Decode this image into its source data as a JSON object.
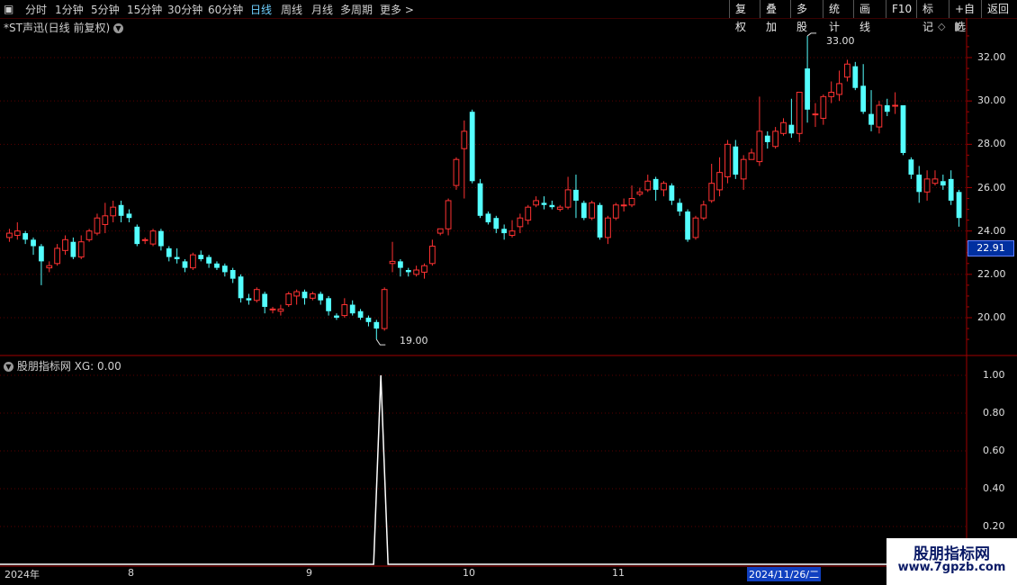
{
  "toolbar": {
    "left_items": [
      "分时",
      "1分钟",
      "5分钟",
      "15分钟",
      "30分钟",
      "60分钟",
      "日线",
      "周线",
      "月线",
      "多周期",
      "更多 >"
    ],
    "active_index": 6,
    "right_items": [
      "复权",
      "叠加",
      "多股",
      "统计",
      "画线",
      "F10",
      "标记",
      "+自选",
      "返回"
    ]
  },
  "chart_title": "*ST声迅(日线 前复权)",
  "indicator_title": "股朋指标网 XG: 0.00",
  "current_price": "22.91",
  "high_marker": "33.00",
  "low_marker": "19.00",
  "x_labels": [
    "2024年",
    "8",
    "9",
    "10",
    "11"
  ],
  "date_highlight": "2024/11/26/二",
  "logo": {
    "cn": "股朋指标网",
    "url": "www.7gpzb.com"
  },
  "colors": {
    "up": "#ff3232",
    "down": "#54ffff",
    "grid": "#5a0000",
    "axis": "#a00000",
    "signal": "#ffffff"
  },
  "chart_data": [
    {
      "type": "candlestick",
      "y_axis_labels": [
        "32.00",
        "30.00",
        "28.00",
        "26.00",
        "24.00",
        "22.00",
        "20.00"
      ],
      "ylim": [
        18.2,
        33.8
      ],
      "candles": [
        [
          23.7,
          23.9,
          23.5,
          24.1
        ],
        [
          23.8,
          24.0,
          23.6,
          24.4
        ],
        [
          23.9,
          23.6,
          23.4,
          24.0
        ],
        [
          23.6,
          23.3,
          22.9,
          23.7
        ],
        [
          23.3,
          22.6,
          21.5,
          23.4
        ],
        [
          22.3,
          22.4,
          22.1,
          22.6
        ],
        [
          22.5,
          23.2,
          22.4,
          23.4
        ],
        [
          23.1,
          23.6,
          22.9,
          23.8
        ],
        [
          23.5,
          22.8,
          22.7,
          23.7
        ],
        [
          22.8,
          23.5,
          22.7,
          23.8
        ],
        [
          23.6,
          24.0,
          23.5,
          24.1
        ],
        [
          23.9,
          24.6,
          23.8,
          24.8
        ],
        [
          24.3,
          24.7,
          23.9,
          25.3
        ],
        [
          24.7,
          25.1,
          24.4,
          25.4
        ],
        [
          25.2,
          24.7,
          24.4,
          25.4
        ],
        [
          24.8,
          24.6,
          24.4,
          25.0
        ],
        [
          24.2,
          23.4,
          23.3,
          24.3
        ],
        [
          23.6,
          23.6,
          23.4,
          23.7
        ],
        [
          23.4,
          24.0,
          23.3,
          24.1
        ],
        [
          24.0,
          23.3,
          23.1,
          24.1
        ],
        [
          23.2,
          22.8,
          22.6,
          23.3
        ],
        [
          22.8,
          22.7,
          22.5,
          23.2
        ],
        [
          22.6,
          22.3,
          22.1,
          22.7
        ],
        [
          22.3,
          22.9,
          22.2,
          23.0
        ],
        [
          22.9,
          22.7,
          22.6,
          23.1
        ],
        [
          22.8,
          22.5,
          22.3,
          22.9
        ],
        [
          22.5,
          22.3,
          22.2,
          22.6
        ],
        [
          22.4,
          22.1,
          21.9,
          22.5
        ],
        [
          22.2,
          21.8,
          21.6,
          22.3
        ],
        [
          21.9,
          20.9,
          20.7,
          22.0
        ],
        [
          20.9,
          20.8,
          20.6,
          21.1
        ],
        [
          20.8,
          21.3,
          20.7,
          21.4
        ],
        [
          21.1,
          20.5,
          20.2,
          21.2
        ],
        [
          20.4,
          20.4,
          20.2,
          20.5
        ],
        [
          20.3,
          20.4,
          20.1,
          20.6
        ],
        [
          20.6,
          21.1,
          20.5,
          21.2
        ],
        [
          21.0,
          21.2,
          20.6,
          21.3
        ],
        [
          21.2,
          20.9,
          20.6,
          21.3
        ],
        [
          20.9,
          21.1,
          20.8,
          21.2
        ],
        [
          21.1,
          20.8,
          20.6,
          21.2
        ],
        [
          20.9,
          20.3,
          20.1,
          21.0
        ],
        [
          20.1,
          20.0,
          19.9,
          20.2
        ],
        [
          20.1,
          20.6,
          20.0,
          20.9
        ],
        [
          20.6,
          20.2,
          20.1,
          20.8
        ],
        [
          20.3,
          20.0,
          19.9,
          20.4
        ],
        [
          20.0,
          19.8,
          19.6,
          20.1
        ],
        [
          19.8,
          19.5,
          19.0,
          19.9
        ],
        [
          19.5,
          21.3,
          19.4,
          21.4
        ],
        [
          22.5,
          22.6,
          22.1,
          23.5
        ],
        [
          22.6,
          22.3,
          21.9,
          22.7
        ],
        [
          22.2,
          22.1,
          21.9,
          22.3
        ],
        [
          22.0,
          22.2,
          21.9,
          22.4
        ],
        [
          22.1,
          22.4,
          21.8,
          22.5
        ],
        [
          22.5,
          23.3,
          22.4,
          23.6
        ],
        [
          23.9,
          24.1,
          23.8,
          24.1
        ],
        [
          24.1,
          25.4,
          23.8,
          25.5
        ],
        [
          26.1,
          27.3,
          25.9,
          27.4
        ],
        [
          27.8,
          28.6,
          25.5,
          29.1
        ],
        [
          29.5,
          26.3,
          26.2,
          29.6
        ],
        [
          26.2,
          24.7,
          24.6,
          26.4
        ],
        [
          24.8,
          24.4,
          24.3,
          24.9
        ],
        [
          24.6,
          24.1,
          23.9,
          24.7
        ],
        [
          24.1,
          23.9,
          23.6,
          24.3
        ],
        [
          23.8,
          24.0,
          23.7,
          24.5
        ],
        [
          24.2,
          24.6,
          23.9,
          24.8
        ],
        [
          24.5,
          25.1,
          24.3,
          25.2
        ],
        [
          25.2,
          25.4,
          25.1,
          25.6
        ],
        [
          25.3,
          25.2,
          25.0,
          25.6
        ],
        [
          25.2,
          25.1,
          25.0,
          25.4
        ],
        [
          25.0,
          25.1,
          24.9,
          25.2
        ],
        [
          25.1,
          25.9,
          25.0,
          26.5
        ],
        [
          25.9,
          25.4,
          24.6,
          26.6
        ],
        [
          25.3,
          24.6,
          24.5,
          25.4
        ],
        [
          24.6,
          25.3,
          24.5,
          25.4
        ],
        [
          25.2,
          23.7,
          23.6,
          25.3
        ],
        [
          23.7,
          24.6,
          23.4,
          24.7
        ],
        [
          24.6,
          25.2,
          24.5,
          25.3
        ],
        [
          25.2,
          25.2,
          24.9,
          25.5
        ],
        [
          25.2,
          25.5,
          25.1,
          26.1
        ],
        [
          25.7,
          25.8,
          25.6,
          26.0
        ],
        [
          25.9,
          26.3,
          25.8,
          26.6
        ],
        [
          26.4,
          25.9,
          25.4,
          26.5
        ],
        [
          25.9,
          26.2,
          25.6,
          26.3
        ],
        [
          26.1,
          25.4,
          25.2,
          26.2
        ],
        [
          25.3,
          24.9,
          24.7,
          25.5
        ],
        [
          24.9,
          23.6,
          23.5,
          25.0
        ],
        [
          23.7,
          24.6,
          23.6,
          24.7
        ],
        [
          24.6,
          25.2,
          24.5,
          25.4
        ],
        [
          25.4,
          26.2,
          25.3,
          27.1
        ],
        [
          25.9,
          26.7,
          25.6,
          27.4
        ],
        [
          26.5,
          28.0,
          26.2,
          28.2
        ],
        [
          27.9,
          26.6,
          26.4,
          28.2
        ],
        [
          26.4,
          27.3,
          25.9,
          27.5
        ],
        [
          27.3,
          27.6,
          27.3,
          27.8
        ],
        [
          27.2,
          28.6,
          27.0,
          30.2
        ],
        [
          28.4,
          28.1,
          27.8,
          28.6
        ],
        [
          27.9,
          28.6,
          27.8,
          28.8
        ],
        [
          28.5,
          29.0,
          28.4,
          29.2
        ],
        [
          28.9,
          28.5,
          28.3,
          30.1
        ],
        [
          28.5,
          30.4,
          28.1,
          30.4
        ],
        [
          31.5,
          29.6,
          29.0,
          33.0
        ],
        [
          29.4,
          29.4,
          28.8,
          29.9
        ],
        [
          29.2,
          30.2,
          28.9,
          30.3
        ],
        [
          30.2,
          30.4,
          29.9,
          30.9
        ],
        [
          30.3,
          30.8,
          30.0,
          31.4
        ],
        [
          31.1,
          31.7,
          30.9,
          31.9
        ],
        [
          31.6,
          30.6,
          30.5,
          31.8
        ],
        [
          30.7,
          29.5,
          29.4,
          31.7
        ],
        [
          29.4,
          28.9,
          28.6,
          30.5
        ],
        [
          28.8,
          29.8,
          28.5,
          30.0
        ],
        [
          29.8,
          29.5,
          29.3,
          30.1
        ],
        [
          29.8,
          29.8,
          29.4,
          30.4
        ],
        [
          29.8,
          27.6,
          27.5,
          29.8
        ],
        [
          27.3,
          26.6,
          26.4,
          27.4
        ],
        [
          26.6,
          25.8,
          25.3,
          27.0
        ],
        [
          25.8,
          26.4,
          25.4,
          26.8
        ],
        [
          26.2,
          26.4,
          26.1,
          26.8
        ],
        [
          26.3,
          26.1,
          25.9,
          26.6
        ],
        [
          26.4,
          25.4,
          25.2,
          26.8
        ],
        [
          25.8,
          24.6,
          24.2,
          25.9
        ]
      ]
    },
    {
      "type": "line",
      "name": "XG",
      "y_axis_labels": [
        "1.00",
        "0.80",
        "0.60",
        "0.40",
        "0.20"
      ],
      "ylim": [
        0,
        1.05
      ],
      "signal_index": 47,
      "values_before": 0,
      "peak": 1.0
    }
  ]
}
